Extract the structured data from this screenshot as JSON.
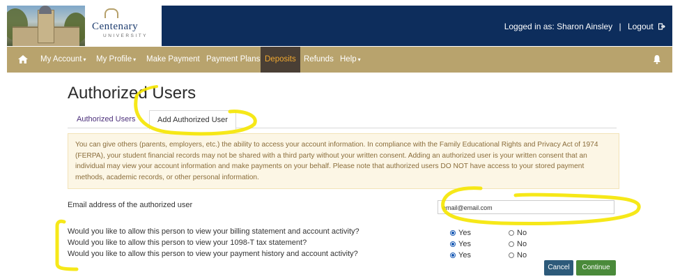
{
  "header": {
    "logo_name": "Centenary",
    "logo_sub": "UNIVERSITY",
    "logged_in": "Logged in as: Sharon Ainsley",
    "separator": "|",
    "logout": "Logout"
  },
  "nav": {
    "items": [
      {
        "label": "My Account",
        "dropdown": true
      },
      {
        "label": "My Profile",
        "dropdown": true
      },
      {
        "label": "Make Payment",
        "dropdown": false
      },
      {
        "label": "Payment Plans",
        "dropdown": false
      },
      {
        "label": "Deposits",
        "dropdown": false,
        "active": true
      },
      {
        "label": "Refunds",
        "dropdown": false
      },
      {
        "label": "Help",
        "dropdown": true
      }
    ]
  },
  "page": {
    "title": "Authorized Users",
    "tabs": [
      "Authorized Users",
      "Add Authorized User"
    ],
    "notice": "You can give others (parents, employers, etc.) the ability to access your account information. In compliance with the Family Educational Rights and Privacy Act of 1974 (FERPA), your student financial records may not be shared with a third party without your written consent. Adding an authorized user is your written consent that an individual may view your account information and make payments on your behalf. Please note that authorized users DO NOT have access to your stored payment methods, academic records, or other personal information.",
    "email_label": "Email address of the authorized user",
    "email_value": "email@email.com",
    "questions": [
      {
        "text": "Would you like to allow this person to view your billing statement and account activity?",
        "selected": "Yes"
      },
      {
        "text": "Would you like to allow this person to view your 1098-T tax statement?",
        "selected": "Yes"
      },
      {
        "text": "Would you like to allow this person to view your payment history and account activity?",
        "selected": "Yes"
      }
    ],
    "yes_label": "Yes",
    "no_label": "No",
    "cancel": "Cancel",
    "continue": "Continue"
  },
  "colors": {
    "header_bg": "#0d2d5c",
    "nav_bg": "#b8a36d",
    "active_nav_bg": "#4a3f35",
    "active_nav_text": "#f0a830",
    "highlight": "#f5e600"
  }
}
